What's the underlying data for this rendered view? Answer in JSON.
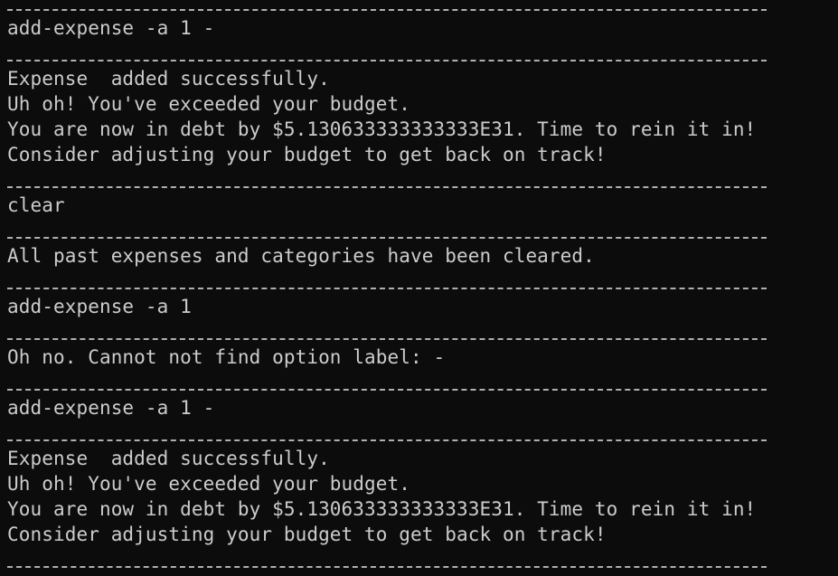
{
  "terminal": {
    "lines": [
      {
        "type": "separator"
      },
      {
        "type": "text",
        "text": "add-expense -a 1 -"
      },
      {
        "type": "separator"
      },
      {
        "type": "text",
        "text": "Expense  added successfully."
      },
      {
        "type": "text",
        "text": "Uh oh! You've exceeded your budget."
      },
      {
        "type": "text",
        "text": "You are now in debt by $5.130633333333333E31. Time to rein it in!"
      },
      {
        "type": "text",
        "text": "Consider adjusting your budget to get back on track!"
      },
      {
        "type": "separator"
      },
      {
        "type": "text",
        "text": "clear"
      },
      {
        "type": "separator"
      },
      {
        "type": "text",
        "text": "All past expenses and categories have been cleared."
      },
      {
        "type": "separator"
      },
      {
        "type": "text",
        "text": "add-expense -a 1"
      },
      {
        "type": "separator"
      },
      {
        "type": "text",
        "text": "Oh no. Cannot not find option label: -"
      },
      {
        "type": "separator"
      },
      {
        "type": "text",
        "text": "add-expense -a 1 -"
      },
      {
        "type": "separator"
      },
      {
        "type": "text",
        "text": "Expense  added successfully."
      },
      {
        "type": "text",
        "text": "Uh oh! You've exceeded your budget."
      },
      {
        "type": "text",
        "text": "You are now in debt by $5.130633333333333E31. Time to rein it in!"
      },
      {
        "type": "text",
        "text": "Consider adjusting your budget to get back on track!"
      },
      {
        "type": "separator"
      }
    ],
    "colors": {
      "background": "#0c0c0c",
      "foreground": "#cccccc"
    }
  }
}
